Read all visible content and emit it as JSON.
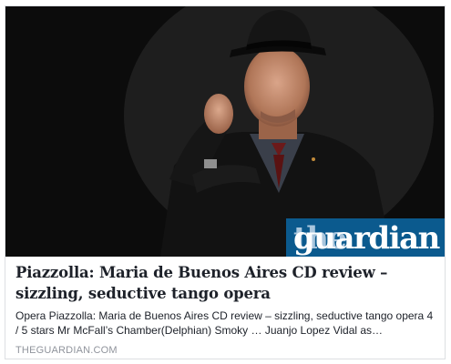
{
  "link_preview": {
    "brand": {
      "part1": "the",
      "part2": "guardian"
    },
    "title": "Piazzolla: Maria de Buenos Aires CD review – sizzling, seductive tango opera",
    "description": "Opera Piazzolla: Maria de Buenos Aires CD review – sizzling, seductive tango opera 4 / 5 stars Mr McFall’s Chamber(Delphian) Smoky … Juanjo Lopez Vidal as…",
    "domain": "THEGUARDIAN.COM"
  },
  "colors": {
    "brand_bg": "#0b5a8e",
    "title": "#1d2129",
    "domain": "#90949c"
  }
}
